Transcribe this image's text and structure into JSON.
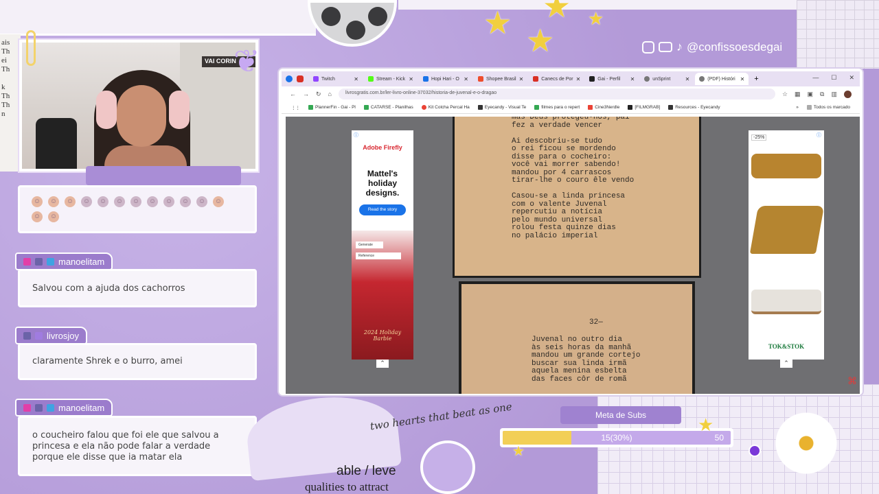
{
  "social": {
    "handle": "@confissoesdegai",
    "icons": [
      "instagram-icon",
      "youtube-icon",
      "tiktok-icon"
    ]
  },
  "webcam": {
    "sign_text": "VAI CORIN"
  },
  "chat": [
    {
      "user": "manoelitam",
      "message": "Salvou com a ajuda dos cachorros"
    },
    {
      "user": "livrosjoy",
      "message": "claramente Shrek e o burro, amei"
    },
    {
      "user": "manoelitam",
      "message": "o coucheiro falou que foi ele que salvou a princesa e ela não pode falar a verdade porque ele disse que ia matar ela"
    }
  ],
  "browser": {
    "tabs": [
      {
        "label": "Twitch",
        "color": "#9146ff"
      },
      {
        "label": "Stream - Kick",
        "color": "#53fc18"
      },
      {
        "label": "Hopi Hari - O",
        "color": "#1a73e8"
      },
      {
        "label": "Shopee Brasil",
        "color": "#ee4d2d"
      },
      {
        "label": "Canecs de Por",
        "color": "#d93025"
      },
      {
        "label": "Gai - Perfil",
        "color": "#222222"
      },
      {
        "label": "unSprint",
        "color": "#555555"
      },
      {
        "label": "(PDF) Históri",
        "color": "#555555"
      }
    ],
    "url": "livrosgratis.com.br/ler-livro-online-37032/historia-de-juvenal-e-o-dragao",
    "bookmarks": [
      {
        "label": "PlannerFin - Gai - Pl",
        "color": "#34a853"
      },
      {
        "label": "CATARSE - Planilhas",
        "color": "#34a853"
      },
      {
        "label": "Kit Colcha Percal Ha",
        "color": "#ea4335"
      },
      {
        "label": "Eyecandy - Visual Te",
        "color": "#333333"
      },
      {
        "label": "filmes para o repert",
        "color": "#34a853"
      },
      {
        "label": "Cine3Nerdle",
        "color": "#ea4335"
      },
      {
        "label": "[FILMGRAB]",
        "color": "#222222"
      },
      {
        "label": "Resources - Eyecandy",
        "color": "#333333"
      }
    ],
    "bookmarks_folder": "Todos os marcado",
    "ad_left": {
      "brand": "Adobe Firefly",
      "headline": "Mattel's holiday designs.",
      "cta": "Read the story",
      "tag1": "Generate",
      "tag2": "Reference",
      "caption": "2024 Holiday Barbie"
    },
    "ad_right": {
      "discount": "-25%",
      "brand": "TOK&STOK"
    },
    "page1_text": "mas Deus protegeu-nos, pai\nfez a verdade vencer\n\nAi descobriu-se tudo\no rei ficou se mordendo\ndisse para o cocheiro:\nvocê vai morrer sabendo!\nmandou por 4 carrascos\ntirar-lhe o couro êle vendo\n\nCasou-se a linda princesa\ncom o valente Juvenal\nrepercutiu a notícia\npelo mundo universal\nrolou festa quinze dias\nno palácio imperial",
    "page2_number": "32—",
    "page2_text": "Juvenal no outro dia\nàs seis horas da manhã\nmandou um grande cortejo\nbuscar sua linda irmã\naquela menina esbelta\ndas faces côr de romã"
  },
  "goal": {
    "label": "Meta de Subs",
    "current_text": "15(30%)",
    "max": "50",
    "progress_pct": 30
  },
  "deco_text": {
    "cursive": "two hearts that beat as one",
    "level": "able / leve",
    "qualities": "qualities to attract"
  }
}
